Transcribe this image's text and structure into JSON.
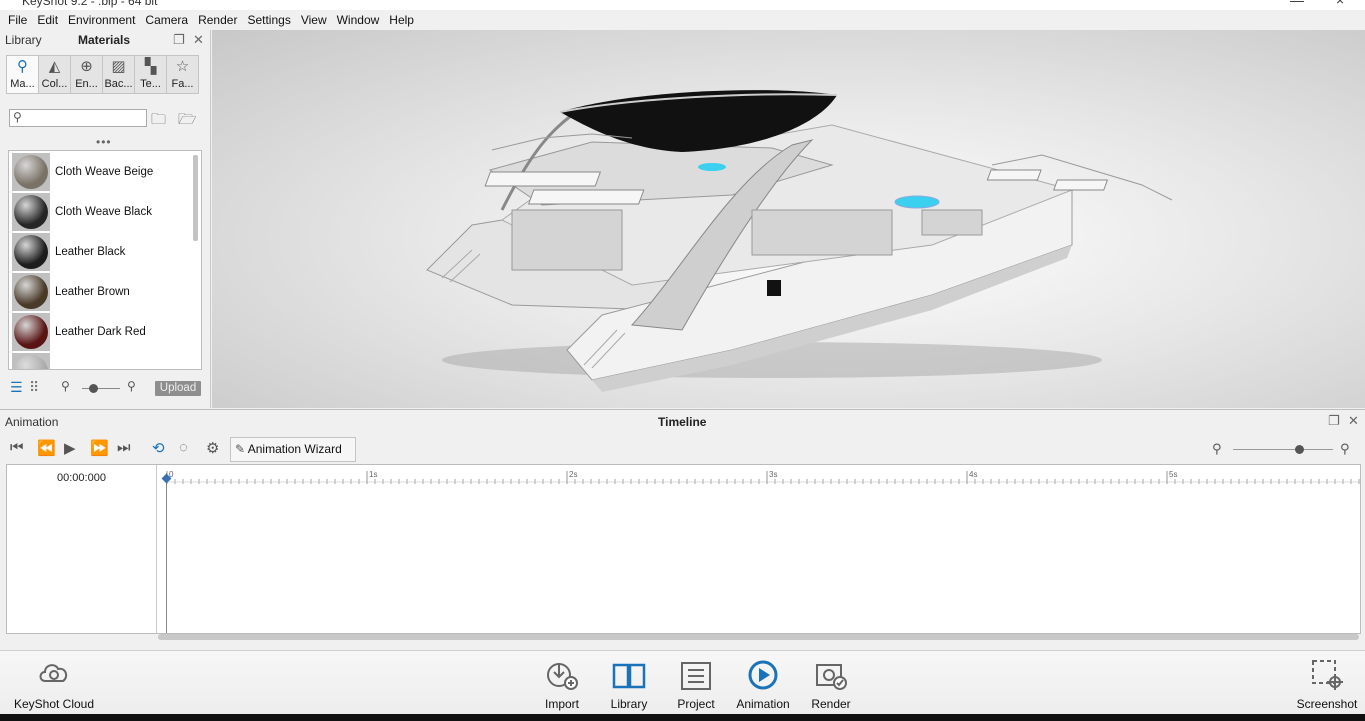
{
  "window": {
    "title": "KeyShot 9.2 - .bip - 64 bit"
  },
  "menu": [
    "File",
    "Edit",
    "Environment",
    "Camera",
    "Render",
    "Settings",
    "View",
    "Window",
    "Help"
  ],
  "library_panel": {
    "library_label": "Library",
    "materials_label": "Materials",
    "tabs": [
      {
        "label": "Ma...",
        "icon": "materials-icon",
        "active": true
      },
      {
        "label": "Col...",
        "icon": "colors-icon",
        "active": false
      },
      {
        "label": "En...",
        "icon": "environments-icon",
        "active": false
      },
      {
        "label": "Bac...",
        "icon": "backplates-icon",
        "active": false
      },
      {
        "label": "Te...",
        "icon": "textures-icon",
        "active": false
      },
      {
        "label": "Fa...",
        "icon": "favorites-icon",
        "active": false
      }
    ],
    "search": {
      "value": "",
      "placeholder": ""
    },
    "materials": [
      {
        "name": "Cloth Weave Beige",
        "color": "#7a7266"
      },
      {
        "name": "Cloth Weave Black",
        "color": "#262626"
      },
      {
        "name": "Leather Black",
        "color": "#1c1c1c"
      },
      {
        "name": "Leather Brown",
        "color": "#4a3a28"
      },
      {
        "name": "Leather Dark Red",
        "color": "#5a1414"
      }
    ],
    "upload_label": "Upload"
  },
  "animation": {
    "panel_label": "Animation",
    "timeline_label": "Timeline",
    "wizard_label": "Animation Wizard",
    "timecode": "00:00:000",
    "ruler_marks": [
      "0",
      "1s",
      "2s",
      "3s",
      "4s",
      "5s"
    ]
  },
  "bottom_toolbar": {
    "cloud": "KeyShot Cloud",
    "import": "Import",
    "library": "Library",
    "project": "Project",
    "animation": "Animation",
    "render": "Render",
    "screenshot": "Screenshot"
  },
  "colors": {
    "accent": "#1a73b8",
    "water": "#3cd0f0"
  }
}
